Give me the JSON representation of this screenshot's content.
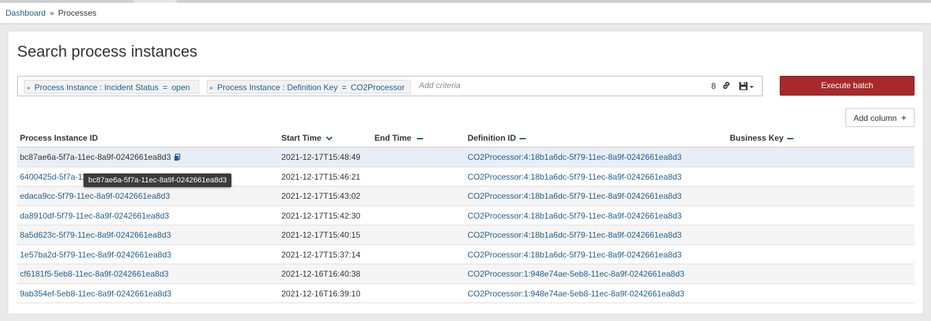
{
  "breadcrumb": {
    "home": "Dashboard",
    "separator": "»",
    "current": "Processes"
  },
  "panel": {
    "title": "Search process instances"
  },
  "search": {
    "criteria": [
      {
        "key": "Process Instance : Incident Status",
        "operator": "=",
        "value": "open"
      },
      {
        "key": "Process Instance : Definition Key",
        "operator": "=",
        "value": "CO2Processor"
      }
    ],
    "placeholder": "Add criteria",
    "result_count": "8",
    "remove_glyph": "×"
  },
  "buttons": {
    "execute_batch": "Execute batch",
    "add_column": "Add column",
    "add_column_glyph": "+"
  },
  "table": {
    "headers": {
      "id": "Process Instance ID",
      "start": "Start Time",
      "end": "End Time",
      "definition": "Definition ID",
      "business_key": "Business Key"
    },
    "rows": [
      {
        "id": "bc87ae6a-5f7a-11ec-8a9f-0242661ea8d3",
        "start": "2021-12-17T15:48:49",
        "definition": "CO2Processor:4:18b1a6dc-5f79-11ec-8a9f-0242661ea8d3"
      },
      {
        "id": "6400425d-5f7a-11ec-8a9f-0242661ea8d3",
        "start": "2021-12-17T15:46:21",
        "definition": "CO2Processor:4:18b1a6dc-5f79-11ec-8a9f-0242661ea8d3"
      },
      {
        "id": "edaca9cc-5f79-11ec-8a9f-0242661ea8d3",
        "start": "2021-12-17T15:43:02",
        "definition": "CO2Processor:4:18b1a6dc-5f79-11ec-8a9f-0242661ea8d3"
      },
      {
        "id": "da8910df-5f79-11ec-8a9f-0242661ea8d3",
        "start": "2021-12-17T15:42:30",
        "definition": "CO2Processor:4:18b1a6dc-5f79-11ec-8a9f-0242661ea8d3"
      },
      {
        "id": "8a5d623c-5f79-11ec-8a9f-0242661ea8d3",
        "start": "2021-12-17T15:40:15",
        "definition": "CO2Processor:4:18b1a6dc-5f79-11ec-8a9f-0242661ea8d3"
      },
      {
        "id": "1e57ba2d-5f79-11ec-8a9f-0242661ea8d3",
        "start": "2021-12-17T15:37:14",
        "definition": "CO2Processor:4:18b1a6dc-5f79-11ec-8a9f-0242661ea8d3"
      },
      {
        "id": "cf6181f5-5eb8-11ec-8a9f-0242661ea8d3",
        "start": "2021-12-16T16:40:38",
        "definition": "CO2Processor:1:948e74ae-5eb8-11ec-8a9f-0242661ea8d3"
      },
      {
        "id": "9ab354ef-5eb8-11ec-8a9f-0242661ea8d3",
        "start": "2021-12-16T16:39:10",
        "definition": "CO2Processor:1:948e74ae-5eb8-11ec-8a9f-0242661ea8d3"
      }
    ]
  },
  "tooltip": {
    "text": "bc87ae6a-5f7a-11ec-8a9f-0242661ea8d3"
  },
  "icons": {
    "remove_criteria": "x-icon",
    "link": "link-icon",
    "save": "save-icon",
    "sort": "chevron-down-icon",
    "remove_column": "minus-icon",
    "copy": "copy-icon",
    "add": "plus-icon"
  },
  "colors": {
    "accent": "#1f5d8c",
    "execute_button": "#a72a2a",
    "highlight_row": "#e8eef6"
  }
}
